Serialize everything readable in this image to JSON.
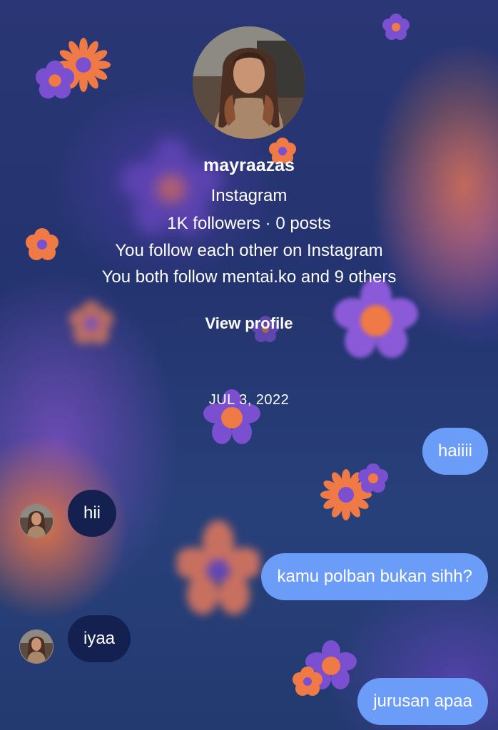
{
  "profile": {
    "username": "mayraazas",
    "platform": "Instagram",
    "stats": "1K followers · 0 posts",
    "mutual_follow": "You follow each other on Instagram",
    "mutual_followers": "You both follow mentai.ko and 9 others",
    "view_profile_label": "View profile",
    "avatar_icon": "profile-photo"
  },
  "conversation": {
    "date_separator": "JUL 3, 2022",
    "messages": [
      {
        "direction": "outgoing",
        "text": "haiiii"
      },
      {
        "direction": "incoming",
        "text": "hii"
      },
      {
        "direction": "outgoing",
        "text": "kamu polban bukan sihh?"
      },
      {
        "direction": "incoming",
        "text": "iyaa"
      },
      {
        "direction": "outgoing",
        "text": "jurusan apaa"
      }
    ]
  },
  "colors": {
    "outgoing_bubble": "#6b9cf7",
    "incoming_bubble": "#14204f",
    "background": "#2a3a78",
    "flower_orange": "#f07a45",
    "flower_purple": "#7a4fd0"
  }
}
